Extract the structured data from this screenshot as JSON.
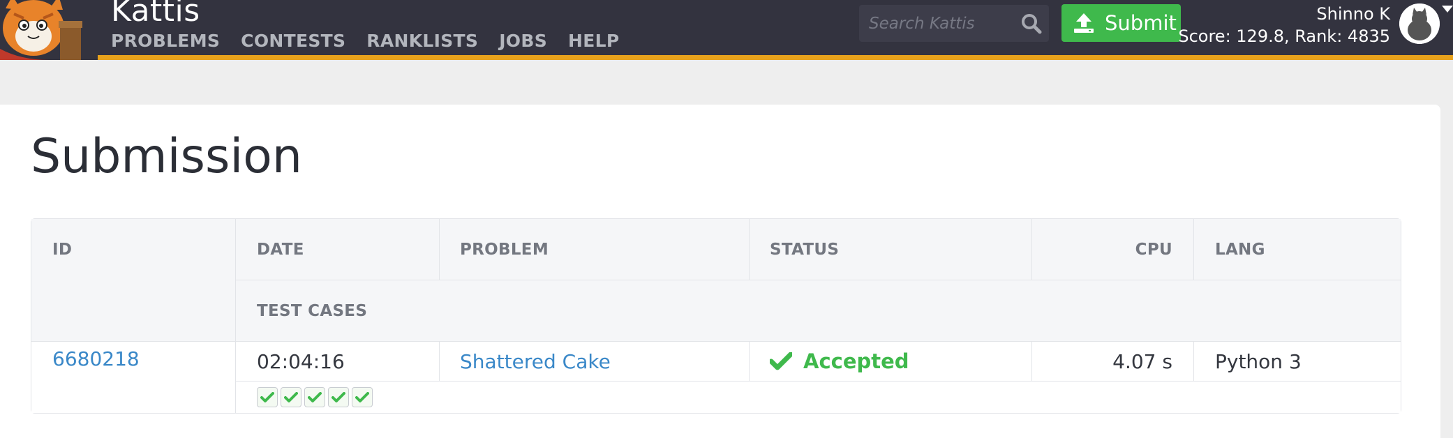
{
  "brand": "Kattis",
  "nav": {
    "problems": "PROBLEMS",
    "contests": "CONTESTS",
    "ranklists": "RANKLISTS",
    "jobs": "JOBS",
    "help": "HELP"
  },
  "search": {
    "placeholder": "Search Kattis"
  },
  "submit_label": "Submit",
  "user": {
    "name": "Shinno K",
    "score_rank": "Score: 129.8, Rank: 4835"
  },
  "page_title": "Submission",
  "table": {
    "headers": {
      "id": "ID",
      "date": "DATE",
      "problem": "PROBLEM",
      "status": "STATUS",
      "cpu": "CPU",
      "lang": "LANG",
      "test_cases": "TEST CASES"
    },
    "row": {
      "id": "6680218",
      "date": "02:04:16",
      "problem": "Shattered Cake",
      "status": "Accepted",
      "cpu": "4.07 s",
      "lang": "Python 3",
      "test_cases_passed": 5
    }
  },
  "colors": {
    "topbar": "#33333f",
    "accent": "#e8a21c",
    "accepted": "#3fb94c",
    "link": "#3a88c8"
  }
}
